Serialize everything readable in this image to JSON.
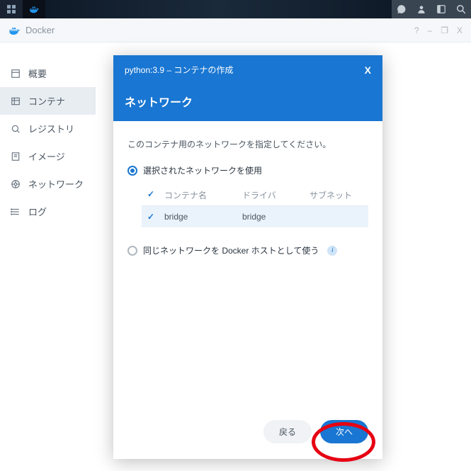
{
  "topbar": {
    "icons": [
      "grid",
      "docker"
    ]
  },
  "app": {
    "title": "Docker",
    "help": "?",
    "min": "–",
    "max": "❐",
    "close": "X"
  },
  "sidebar": {
    "items": [
      {
        "label": "概要"
      },
      {
        "label": "コンテナ"
      },
      {
        "label": "レジストリ"
      },
      {
        "label": "イメージ"
      },
      {
        "label": "ネットワーク"
      },
      {
        "label": "ログ"
      }
    ]
  },
  "modal": {
    "title": "python:3.9 – コンテナの作成",
    "close": "X",
    "heading": "ネットワーク",
    "description": "このコンテナ用のネットワークを指定してください。",
    "option1": "選択されたネットワークを使用",
    "option2": "同じネットワークを Docker ホストとして使う",
    "table": {
      "headers": {
        "name": "コンテナ名",
        "driver": "ドライバ",
        "subnet": "サブネット"
      },
      "rows": [
        {
          "name": "bridge",
          "driver": "bridge",
          "subnet": ""
        }
      ]
    },
    "back": "戻る",
    "next": "次へ"
  }
}
